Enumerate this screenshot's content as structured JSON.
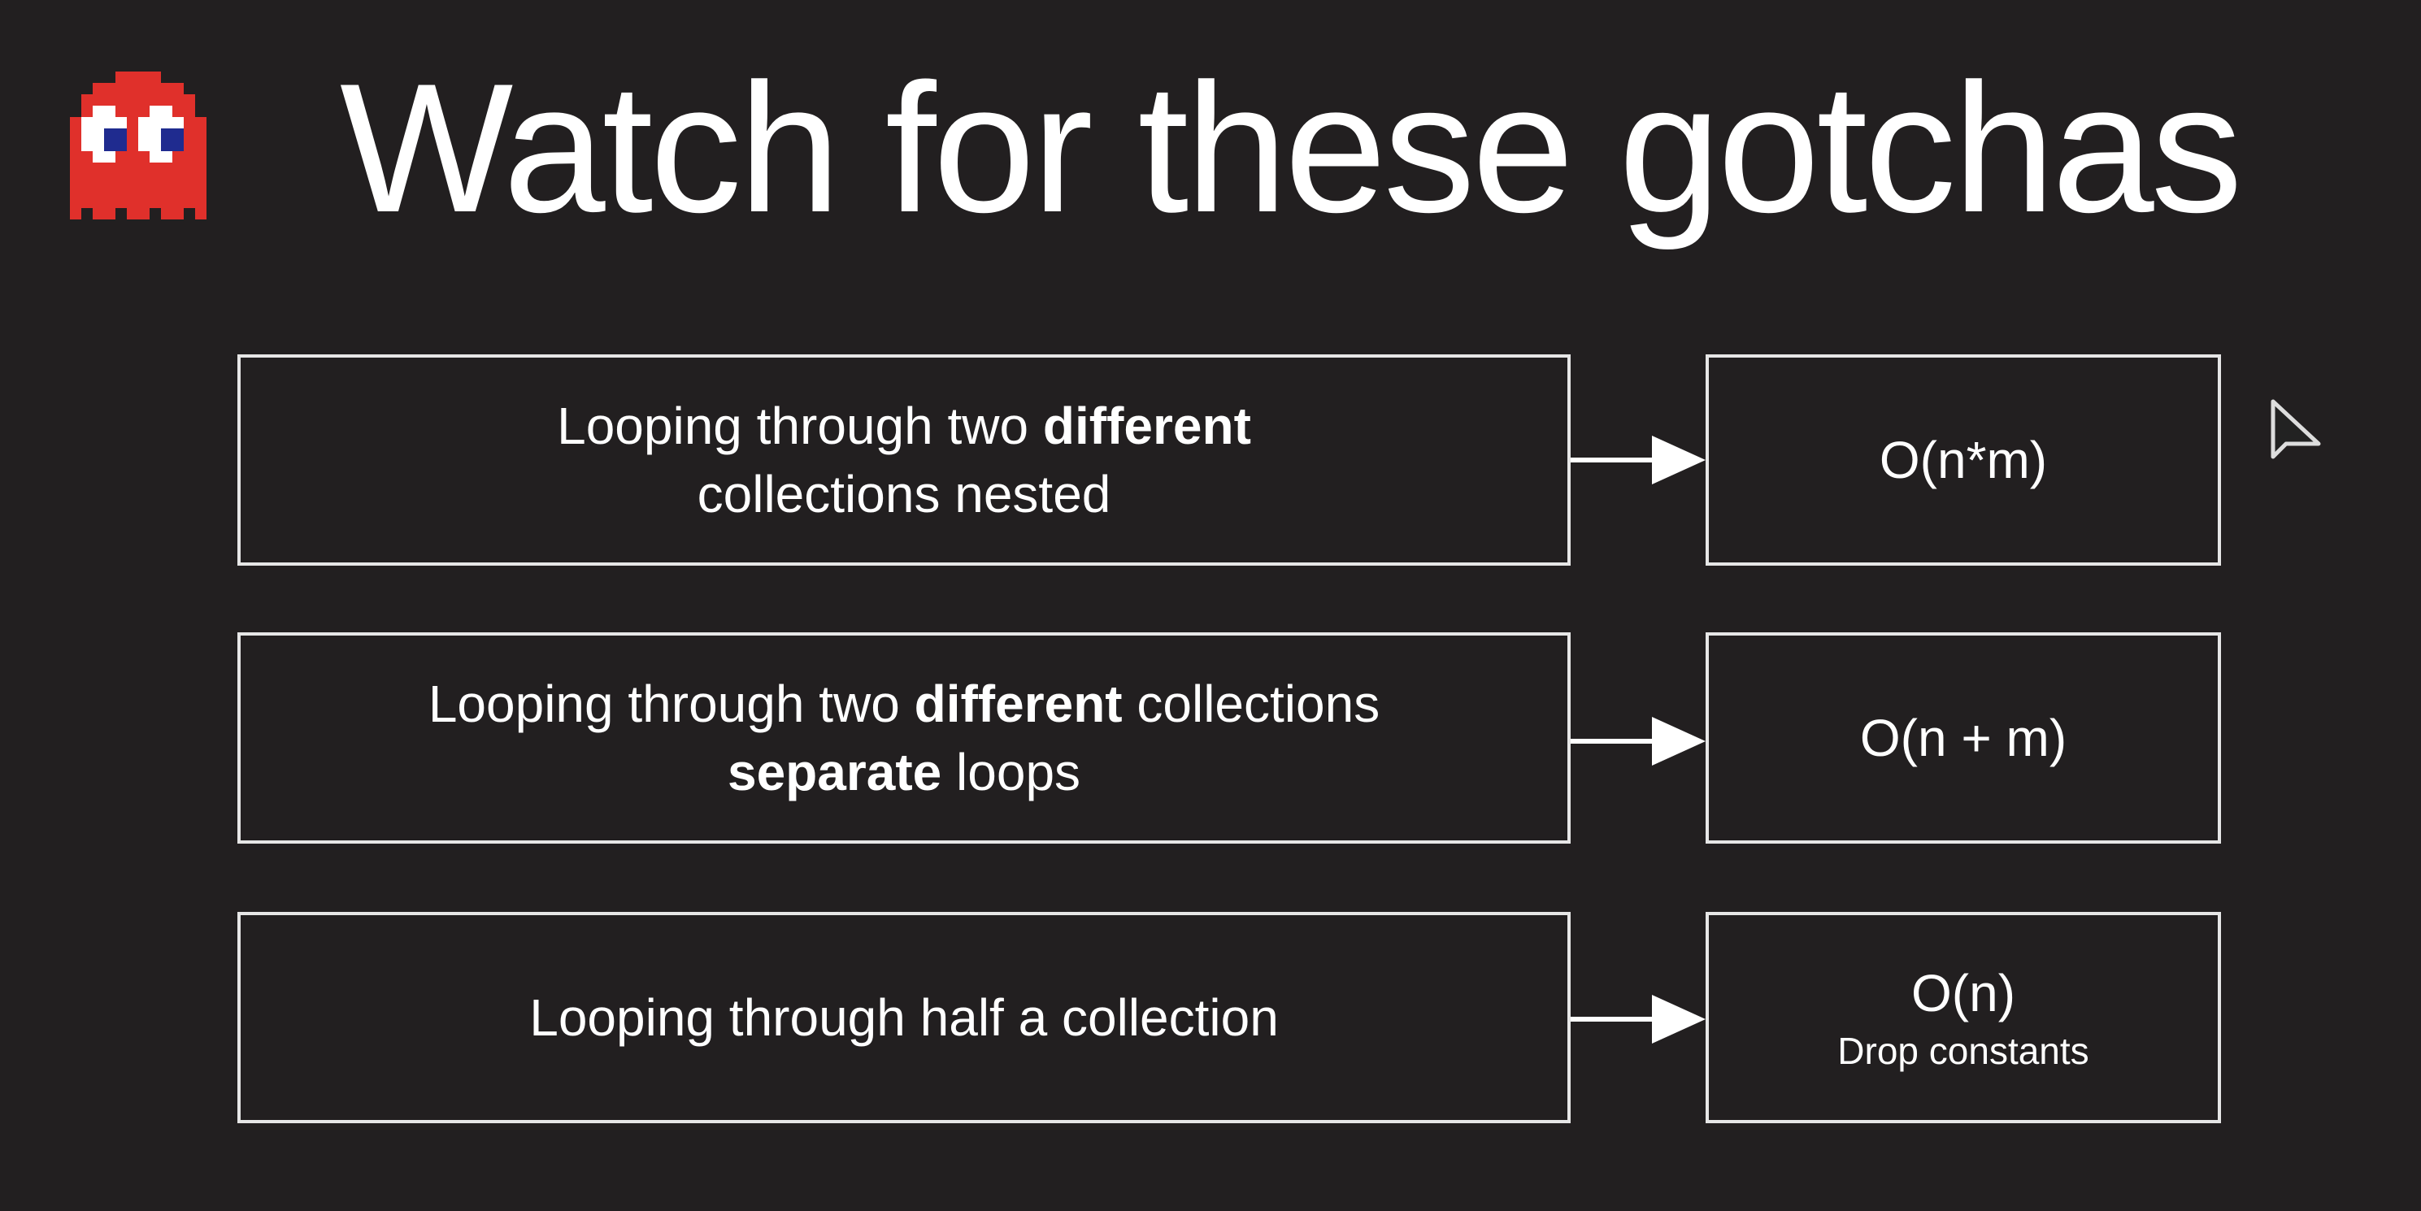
{
  "title": "Watch for these gotchas",
  "rows": [
    {
      "left": {
        "t1": "Looping through two ",
        "b1": "different",
        "line2": "collections nested"
      },
      "right": {
        "main": "O(n*m)"
      }
    },
    {
      "left": {
        "t1": "Looping through two ",
        "b1": "different",
        "t2": " collections",
        "b2": "separate",
        "t3": " loops"
      },
      "right": {
        "main": "O(n + m)"
      }
    },
    {
      "left": {
        "t1": "Looping through half a collection"
      },
      "right": {
        "main": "O(n)",
        "sub": "Drop constants"
      }
    }
  ],
  "colors": {
    "background": "#221f20",
    "ghost": "#e0302b",
    "eye_pupil": "#1f2b8f"
  }
}
